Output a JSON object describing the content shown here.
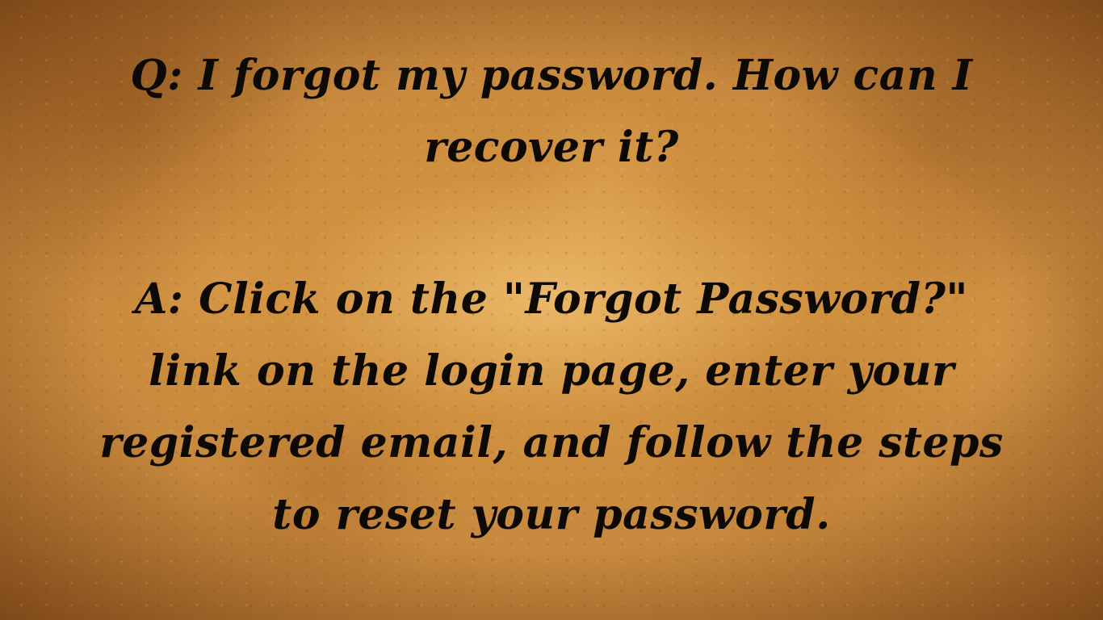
{
  "question": {
    "line1": "Q: I forgot my password. How can I",
    "line2": "recover it?"
  },
  "answer": {
    "line1": "A: Click on the \"Forgot Password?\"",
    "line2": "link on the login page, enter your",
    "line3": "registered email, and follow the steps",
    "line4": "to reset your password."
  },
  "colors": {
    "text": "#0d0905",
    "background": "#c88a3e"
  }
}
